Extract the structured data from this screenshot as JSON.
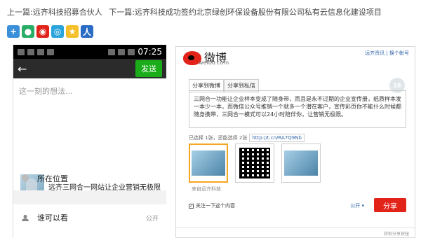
{
  "nav": {
    "prev": "上一篇:远齐科技招募合伙人",
    "next": "下一篇:远齐科技成功签约北京绿创环保设备股份有限公司私有云信息化建设项目"
  },
  "share_icons": [
    {
      "name": "share-plus-icon",
      "color": "#3a8fd8",
      "glyph": "+"
    },
    {
      "name": "wechat-icon",
      "color": "#2aae67",
      "glyph": "●"
    },
    {
      "name": "weibo-icon",
      "color": "#e2231a",
      "glyph": "◉"
    },
    {
      "name": "tencent-weibo-icon",
      "color": "#2aa4db",
      "glyph": "◎"
    },
    {
      "name": "qzone-icon",
      "color": "#f6c02b",
      "glyph": "★"
    },
    {
      "name": "renren-icon",
      "color": "#2a6bc4",
      "glyph": "人"
    }
  ],
  "phone": {
    "time": "07:25",
    "send_label": "发送",
    "placeholder": "这一刻的想法...",
    "card_title": "远齐三网合一网站让企业营销无极限",
    "location_label": "所在位置",
    "visibility_label": "谁可以看",
    "visibility_value": "公开"
  },
  "weibo": {
    "brand": "微博",
    "url": "weibo.com",
    "links": "远齐资讯 | 换个帐号",
    "tab1": "分享到微博",
    "tab2": "分享到私信",
    "count": "28",
    "content": "三网合一功能让企业样本变成了随身带，而且是永不过期的企业宣传册，纸质样本发一本少一本，而微信公众号推销一个就多一个潜在客户，宣传彩页你不能什么时候都随身携带，三网合一模式可以24小时陪伴你，让营销无极限。",
    "selected_text": "已选择 1张，还能选择 2张",
    "short_link": "http://t.cn/RA7Q9Nb",
    "img_caption": "来自远齐科技",
    "follow_label": "关注一下这个内容",
    "public_label": "公开 ▾",
    "share_label": "分享",
    "footer": "获取分享按钮"
  }
}
